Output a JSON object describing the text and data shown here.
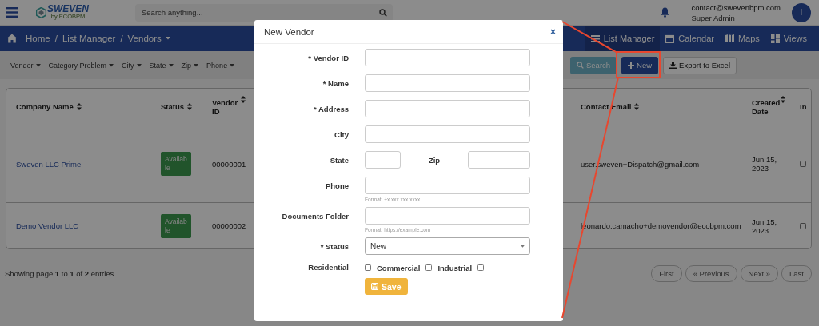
{
  "top_bar": {
    "logo": {
      "name": "SWEVEN",
      "tagline": "by ECOBPM"
    },
    "search": {
      "placeholder": "Search anything..."
    },
    "user": {
      "email": "contact@swevenbpm.com",
      "role": "Super Admin",
      "initial": "I"
    }
  },
  "nav": {
    "breadcrumb": [
      {
        "kind": "link",
        "label": "Home",
        "dropdown": false
      },
      {
        "kind": "separator",
        "label": "/"
      },
      {
        "kind": "link",
        "label": "List Manager",
        "dropdown": false
      },
      {
        "kind": "separator",
        "label": "/"
      },
      {
        "kind": "link",
        "label": "Vendors",
        "dropdown": true
      }
    ],
    "views": [
      {
        "kind": "list",
        "label": "List Manager",
        "selected": true
      },
      {
        "kind": "calendar",
        "label": "Calendar",
        "selected": false
      },
      {
        "kind": "map",
        "label": "Maps",
        "selected": false
      },
      {
        "kind": "grid",
        "label": "Views",
        "selected": false
      }
    ]
  },
  "filters": [
    {
      "label": "Vendor"
    },
    {
      "label": "Category Problem"
    },
    {
      "label": "City"
    },
    {
      "label": "State"
    },
    {
      "label": "Zip"
    },
    {
      "label": "Phone"
    }
  ],
  "actions": [
    {
      "kind": "search",
      "label": "Search"
    },
    {
      "kind": "new",
      "label": "New"
    },
    {
      "kind": "export",
      "label": "Export to Excel"
    }
  ],
  "table": {
    "columns": [
      {
        "label": "Company Name",
        "sortable": true
      },
      {
        "label": "Status",
        "sortable": true
      },
      {
        "label": "Vendor ID",
        "sortable": true
      },
      {
        "label": "Contact Email",
        "sortable": true
      },
      {
        "label": "Created Date",
        "sortable": true
      },
      {
        "label": "In",
        "sortable": false
      }
    ],
    "rows": [
      {
        "company": "Sweven LLC Prime",
        "status": "Available",
        "vendor_id": "00000001",
        "contact_email": "user.sweven+Dispatch@gmail.com",
        "created_date": "Jun 15, 2023",
        "checked": false
      },
      {
        "company": "Demo Vendor LLC",
        "status": "Available",
        "vendor_id": "00000002",
        "contact_email": "leonardo.camacho+demovendor@ecobpm.com",
        "created_date": "Jun 15, 2023",
        "checked": false
      }
    ]
  },
  "pagination": {
    "summary": "Showing page **1** to **1** of **2** entries",
    "buttons": [
      "First",
      "« Previous",
      "Next »",
      "Last"
    ]
  },
  "modal": {
    "title": "New Vendor",
    "close": "×",
    "fields": [
      {
        "kind": "text",
        "label": "* Vendor ID"
      },
      {
        "kind": "text",
        "label": "* Name"
      },
      {
        "kind": "text",
        "label": "* Address"
      },
      {
        "kind": "text",
        "label": "City"
      },
      {
        "kind": "pair",
        "label": "State",
        "label_2": "Zip"
      },
      {
        "kind": "text",
        "label": "Phone",
        "hint": "Format: +x xxx xxx xxxx"
      },
      {
        "kind": "text",
        "label": "Documents Folder",
        "hint": "Format: https://example.com"
      },
      {
        "kind": "select",
        "label": "* Status",
        "value": "New"
      },
      {
        "kind": "checkboxes",
        "options": [
          {
            "label": "Residential",
            "checked": false
          },
          {
            "label": "Commercial",
            "checked": false
          },
          {
            "label": "Industrial",
            "checked": false
          }
        ]
      }
    ],
    "save": "Save"
  }
}
